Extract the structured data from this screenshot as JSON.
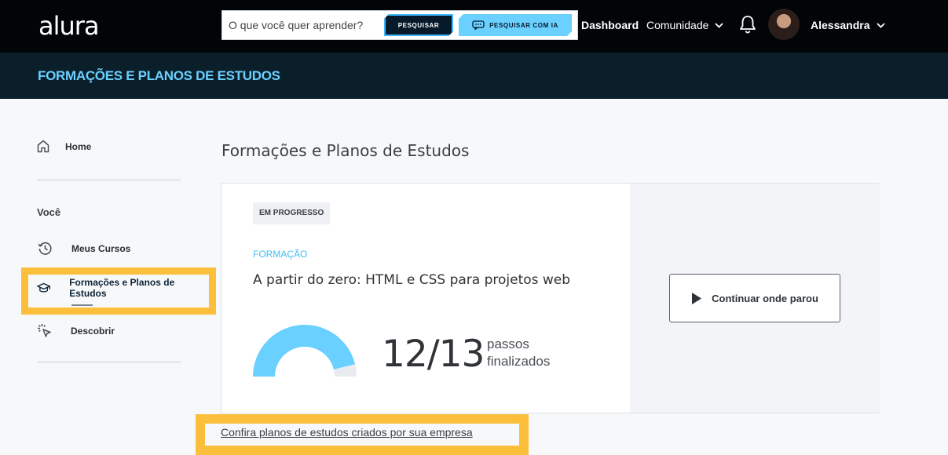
{
  "app": {
    "logo_text": "alura",
    "brand_color": "#6ad0ff",
    "highlight_color": "#fcbf3c"
  },
  "header": {
    "search": {
      "placeholder": "O que você quer aprender?",
      "button_label": "PESQUISAR",
      "ai_button_label": "PESQUISAR COM IA"
    },
    "nav": {
      "dashboard": "Dashboard",
      "community": "Comunidade"
    },
    "user": {
      "name": "Alessandra"
    },
    "icons": [
      "chevron-down-icon",
      "bell-icon",
      "avatar"
    ]
  },
  "band": {
    "title": "FORMAÇÕES E PLANOS DE ESTUDOS"
  },
  "sidebar": {
    "home": "Home",
    "section_title": "Você",
    "items": [
      {
        "label": "Meus Cursos",
        "icon": "history-icon"
      },
      {
        "label": "Formações e Planos de Estudos",
        "icon": "graduation-cap-icon",
        "active": true
      },
      {
        "label": "Descobrir",
        "icon": "sparkle-cursor-icon"
      }
    ]
  },
  "main": {
    "title": "Formações e Planos de Estudos",
    "card": {
      "status_badge": "EM PROGRESSO",
      "kind": "FORMAÇÃO",
      "course_title": "A partir do zero: HTML e CSS para projetos web",
      "steps_done": 12,
      "steps_total": 13,
      "steps_count_text": "12/13",
      "steps_label": "passos finalizados",
      "continue_label": "Continuar onde parou"
    },
    "company_link": "Confira planos de estudos criados por sua empresa"
  }
}
